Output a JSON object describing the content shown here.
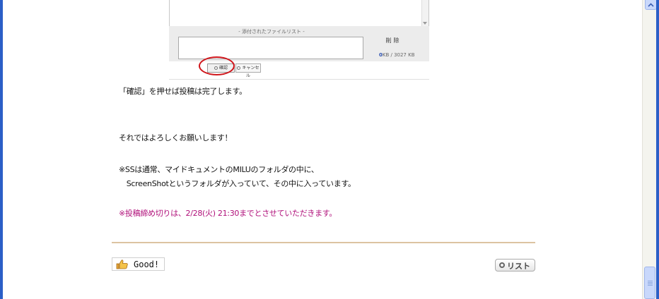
{
  "embedded_form": {
    "attach_list_title": "- 添付されたファイルリスト -",
    "delete_label": "削除",
    "size_used": "0",
    "size_rest": "KB / 3027 KB",
    "confirm_label": "確認",
    "cancel_label": "キャンセル"
  },
  "article": {
    "line1": "「確認」を押せば投稿は完了します。",
    "line2": "それではよろしくお願いします！",
    "line3": "※SSは通常、マイドキュメントのMILUのフォルダの中に、",
    "line4": "　ScreenShotというフォルダが入っていて、その中に入っています。",
    "line5": "※投稿締め切りは、2/28(火) 21:30までとさせていただきます。"
  },
  "footer": {
    "good_label": "Good!",
    "list_label": "リスト"
  },
  "colors": {
    "highlight_circle": "#d0161b",
    "deadline_text": "#b0107a",
    "divider": "#dcc3a1"
  }
}
